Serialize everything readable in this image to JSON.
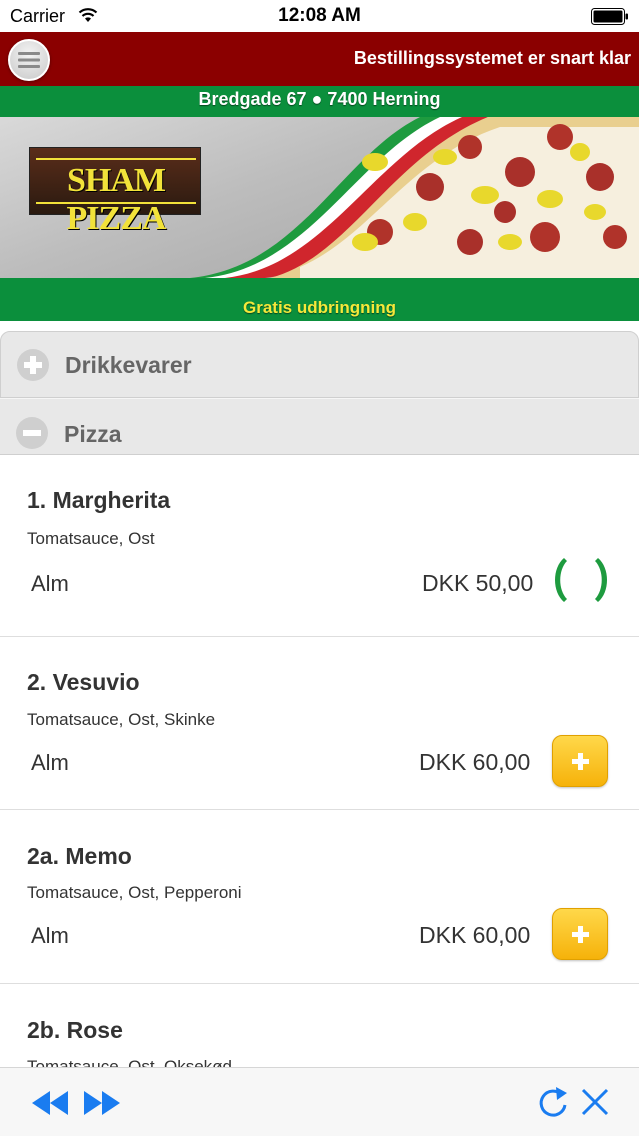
{
  "status_bar": {
    "carrier": "Carrier",
    "time": "12:08 AM"
  },
  "header": {
    "title": "Bestillingssystemet er snart klar",
    "address": "Bredgade 67 ● 7400 Herning"
  },
  "banner": {
    "logo_text": "SHAM PIZZA",
    "delivery_text": "Gratis udbringning"
  },
  "categories": [
    {
      "label": "Drikkevarer",
      "expanded": false,
      "icon": "plus-circle-icon"
    },
    {
      "label": "Pizza",
      "expanded": true,
      "icon": "minus-circle-icon"
    }
  ],
  "items": [
    {
      "name": "1. Margherita",
      "description": "Tomatsauce, Ost",
      "size": "Alm",
      "price": "DKK 50,00",
      "action": "loading-spinner-icon"
    },
    {
      "name": "2. Vesuvio",
      "description": "Tomatsauce, Ost, Skinke",
      "size": "Alm",
      "price": "DKK 60,00",
      "action": "add-icon"
    },
    {
      "name": "2a. Memo",
      "description": "Tomatsauce, Ost, Pepperoni",
      "size": "Alm",
      "price": "DKK 60,00",
      "action": "add-icon"
    },
    {
      "name": "2b. Rose",
      "description": "Tomatsauce, Ost, Oksekød",
      "size": "",
      "price": "",
      "action": ""
    }
  ],
  "toolbar": {
    "icons": [
      "rewind-icon",
      "fast-forward-icon",
      "reload-icon",
      "close-icon"
    ]
  },
  "colors": {
    "header_red": "#8b0000",
    "green": "#0b8f3c",
    "yellow_text": "#f5e83a",
    "add_button": "#f6b20a",
    "toolbar_blue": "#1a7cf0"
  }
}
